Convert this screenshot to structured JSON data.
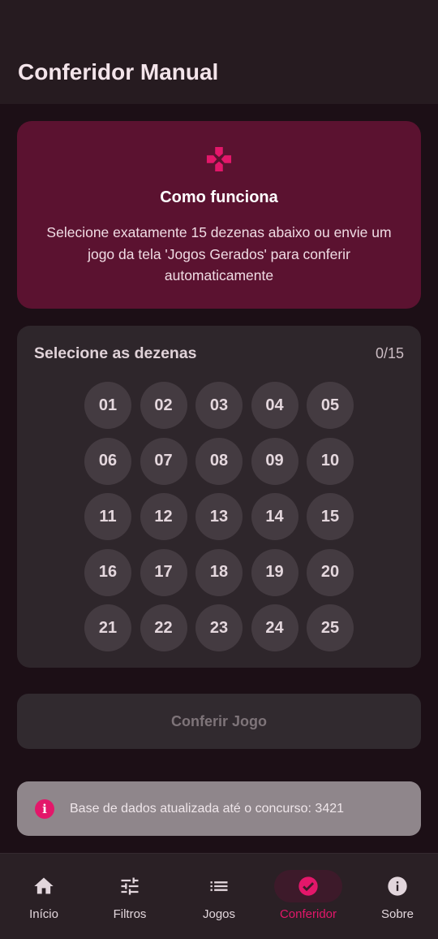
{
  "app_bar": {
    "title": "Conferidor Manual"
  },
  "info_card": {
    "icon": "diamond-cross-icon",
    "title": "Como funciona",
    "text": "Selecione exatamente 15 dezenas abaixo ou envie um jogo da tela 'Jogos Gerados' para conferir automaticamente"
  },
  "selector": {
    "title": "Selecione as dezenas",
    "count": "0/15",
    "numbers": [
      "01",
      "02",
      "03",
      "04",
      "05",
      "06",
      "07",
      "08",
      "09",
      "10",
      "11",
      "12",
      "13",
      "14",
      "15",
      "16",
      "17",
      "18",
      "19",
      "20",
      "21",
      "22",
      "23",
      "24",
      "25"
    ]
  },
  "conferir_button": {
    "label": "Conferir Jogo"
  },
  "snackbar": {
    "icon": "info-icon",
    "text": "Base de dados atualizada até o concurso: 3421"
  },
  "bottom_nav": {
    "items": [
      {
        "label": "Início",
        "icon": "home-icon",
        "active": false
      },
      {
        "label": "Filtros",
        "icon": "tune-icon",
        "active": false
      },
      {
        "label": "Jogos",
        "icon": "list-icon",
        "active": false
      },
      {
        "label": "Conferidor",
        "icon": "check-circle-icon",
        "active": true
      },
      {
        "label": "Sobre",
        "icon": "info-icon",
        "active": false
      }
    ]
  },
  "colors": {
    "accent": "#e3176a",
    "background": "#1c0f16",
    "info_card": "#5b1230",
    "surface": "#2e262b"
  }
}
